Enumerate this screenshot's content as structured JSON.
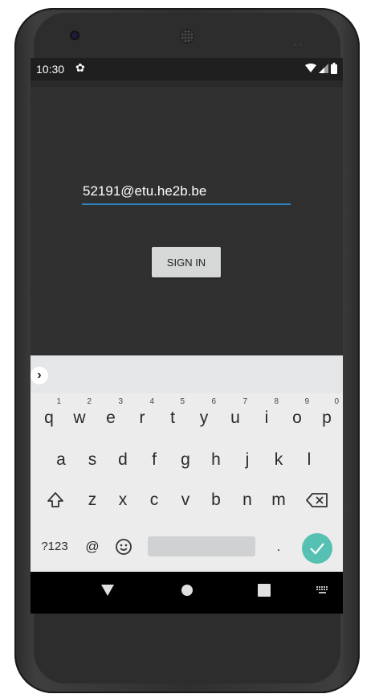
{
  "status": {
    "time": "10:30",
    "settings_icon": "gear-icon",
    "wifi_icon": "wifi-icon",
    "signal_icon": "signal-icon",
    "battery_icon": "battery-icon"
  },
  "login": {
    "email_value": "52191@etu.he2b.be",
    "sign_in_label": "SIGN IN"
  },
  "keyboard": {
    "row1": [
      {
        "key": "q",
        "hint": "1"
      },
      {
        "key": "w",
        "hint": "2"
      },
      {
        "key": "e",
        "hint": "3"
      },
      {
        "key": "r",
        "hint": "4"
      },
      {
        "key": "t",
        "hint": "5"
      },
      {
        "key": "y",
        "hint": "6"
      },
      {
        "key": "u",
        "hint": "7"
      },
      {
        "key": "i",
        "hint": "8"
      },
      {
        "key": "o",
        "hint": "9"
      },
      {
        "key": "p",
        "hint": "0"
      }
    ],
    "row2": [
      "a",
      "s",
      "d",
      "f",
      "g",
      "h",
      "j",
      "k",
      "l"
    ],
    "row3": [
      "z",
      "x",
      "c",
      "v",
      "b",
      "n",
      "m"
    ],
    "symbols_label": "?123",
    "at_label": "@",
    "period_label": "."
  },
  "colors": {
    "accent": "#2f84c5",
    "enter": "#56c0b2",
    "screen_bg": "#303030"
  }
}
